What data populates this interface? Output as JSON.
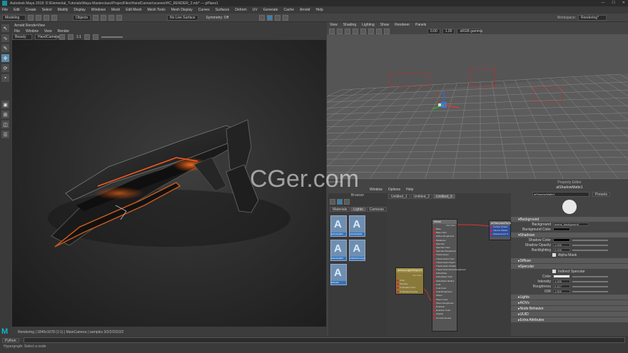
{
  "title_bar": {
    "text": "Autodesk Maya 2018: D:\\Elemental_Tutorials\\Maya Masterclass\\ProjectFiles\\HandCannon\\scenes\\HC_RENDER_2.mb*   ---   pPlane1"
  },
  "menus": [
    "File",
    "Edit",
    "Create",
    "Select",
    "Modify",
    "Display",
    "Windows",
    "Mesh",
    "Edit Mesh",
    "Mesh Tools",
    "Mesh Display",
    "Curves",
    "Surfaces",
    "Deform",
    "UV",
    "Generate",
    "Cache",
    "Arnold",
    "Help"
  ],
  "status_line": {
    "menu_set": "Modeling",
    "objects_label": "Objects",
    "live_surface": "No Live Surface",
    "symmetry": "Symmetry: Off",
    "workspace_label": "Workspace:",
    "workspace": "Rendering*"
  },
  "render_view": {
    "title": "Arnold RenderView",
    "menu": [
      "File",
      "Window",
      "View",
      "Render"
    ],
    "camera_dropdown": "Beauty",
    "camera": "HandCamera",
    "ratio": "1:1",
    "status": "Rendering | 1840x1078 (1:1) | MainCamera | samples 3/2/2/2/2/2/2"
  },
  "viewport": {
    "menu": [
      "View",
      "Shading",
      "Lighting",
      "Show",
      "Renderer",
      "Panels"
    ],
    "values": [
      "0.00",
      "1.00"
    ],
    "color_space": "sRGB gamma"
  },
  "hypershade": {
    "label": "Hypershade",
    "menu": [
      "Window",
      "Options",
      "Help"
    ],
    "browser_title": "Browser",
    "browser_tabs": [
      "Materials",
      "Lights",
      "Cameras"
    ],
    "lights": [
      {
        "label": "aiAreaLight1"
      },
      {
        "label": "aiAreaLight2"
      },
      {
        "label": "aiAreaLight3"
      },
      {
        "label": "aiSkyDomeLight"
      },
      {
        "label": "aiAreaLi"
      }
    ],
    "graph_tabs": [
      "Untitled_1",
      "Untitled_2",
      "Untitled_3"
    ],
    "metal_node": {
      "title": "Metal",
      "sub": "Out Color",
      "ports": [
        "Base",
        "Base Color",
        "Diffuse Roughness",
        "Metalness",
        "Specular",
        "Specular Color",
        "Specular Roughness",
        "Transmission",
        "Transmission Color",
        "Transmission Depth",
        "Transmission Scatter",
        "Transmission Extra Roughness",
        "Subsurface",
        "Subsurface Color",
        "Subsurface Radius",
        "Coat",
        "Coat Color",
        "Coat Roughness",
        "Sheen",
        "Sheen Color",
        "Sheen Roughness",
        "Emission",
        "Emission Color",
        "Opacity",
        "Normal Camera"
      ]
    },
    "light_node": {
      "title": "aiAreaLightShape3",
      "sub": "Out Color",
      "ports": [
        "Color",
        "Intensity",
        "Ai Shadow Color",
        "Ai Shadow Density"
      ]
    },
    "sg_node": {
      "title": "aiStandardSurfa",
      "ports": [
        "Surface Shader",
        "Volume Shader",
        "Displacement S"
      ]
    }
  },
  "attr_editor": {
    "label": "Property Editor",
    "node": "aiShadowMatte1",
    "node_field": "aiShadowMatte1",
    "presets": "Presets",
    "sections": [
      {
        "name": "Background",
        "open": true
      },
      {
        "name": "Shadows",
        "open": true
      },
      {
        "name": "Diffuse",
        "open": false
      },
      {
        "name": "Specular",
        "open": true
      },
      {
        "name": "Lights",
        "open": false
      },
      {
        "name": "AOVs",
        "open": false
      },
      {
        "name": "Node Behavior",
        "open": false
      },
      {
        "name": "UUID",
        "open": false
      },
      {
        "name": "Extra Attributes",
        "open": false
      }
    ],
    "bg_label": "Background",
    "bg_value": "scene_background",
    "bg_color_label": "Background Color",
    "shadow_color_label": "Shadow Color",
    "shadow_opacity_label": "Shadow Opacity",
    "shadow_opacity": "1.000",
    "backlighting_label": "Backlighting",
    "backlighting": "0.000",
    "alpha_mask": "Alpha Mask",
    "indirect_specular": "Indirect Specular",
    "color_label": "Color",
    "intensity_label": "Intensity",
    "intensity": "1.000",
    "roughness_label": "Roughness",
    "roughness": "0.417",
    "ior_label": "IOR",
    "ior": "1.500"
  },
  "command_line": {
    "lang": "Python",
    "help": "Hypergraph: Select a node"
  },
  "watermark": "CGer.com"
}
